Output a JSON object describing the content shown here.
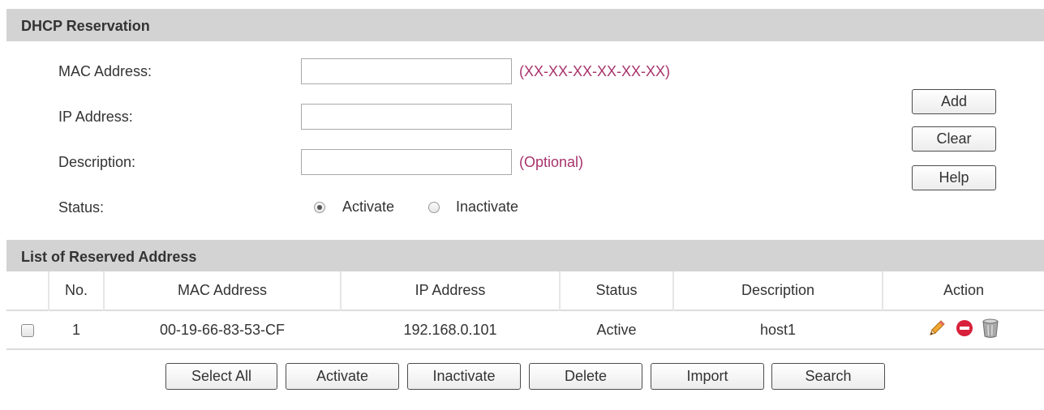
{
  "reservation": {
    "header": "DHCP Reservation",
    "mac_label": "MAC Address:",
    "mac_value": "",
    "mac_hint": "(XX-XX-XX-XX-XX-XX)",
    "ip_label": "IP Address:",
    "ip_value": "",
    "desc_label": "Description:",
    "desc_value": "",
    "desc_hint": "(Optional)",
    "status_label": "Status:",
    "status_options": [
      "Activate",
      "Inactivate"
    ],
    "status_selected": "Activate",
    "buttons": {
      "add": "Add",
      "clear": "Clear",
      "help": "Help"
    }
  },
  "list": {
    "header": "List of Reserved Address",
    "columns": [
      "",
      "No.",
      "MAC Address",
      "IP Address",
      "Status",
      "Description",
      "Action"
    ],
    "rows": [
      {
        "checked": false,
        "no": "1",
        "mac": "00-19-66-83-53-CF",
        "ip": "192.168.0.101",
        "status": "Active",
        "description": "host1",
        "actions": [
          "edit-icon",
          "disable-icon",
          "delete-icon"
        ]
      }
    ]
  },
  "bottom_buttons": {
    "select_all": "Select All",
    "activate": "Activate",
    "inactivate": "Inactivate",
    "delete": "Delete",
    "import": "Import",
    "search": "Search"
  },
  "colors": {
    "header_bg": "#d3d3d3",
    "hint": "#a8336b",
    "edit_icon": "#e8a020",
    "disable_icon": "#d8203a",
    "delete_icon": "#8a8a8a"
  }
}
